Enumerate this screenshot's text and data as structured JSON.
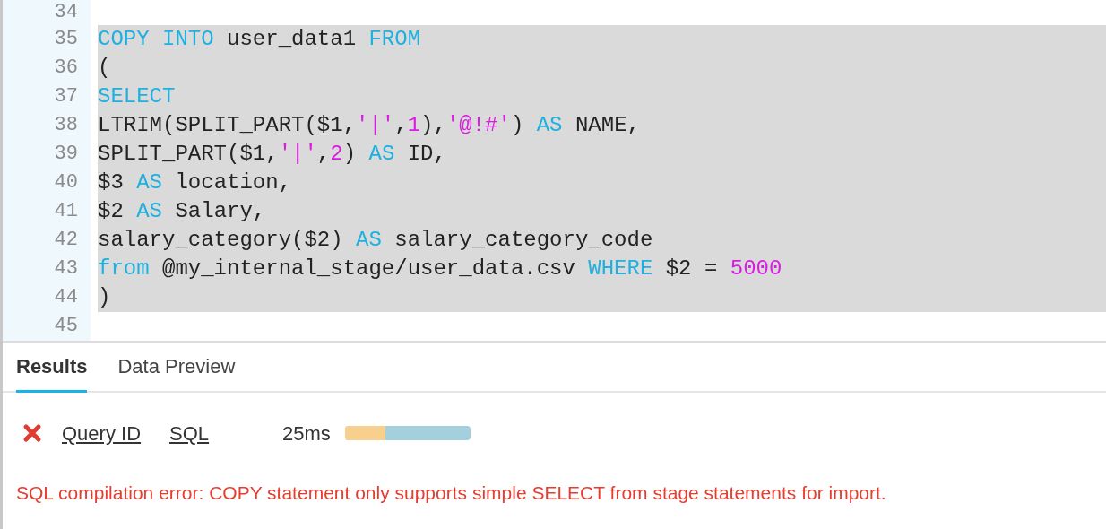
{
  "editor": {
    "lines": [
      {
        "number": "34",
        "selected": false
      },
      {
        "number": "35",
        "selected": true,
        "tokens": [
          {
            "kind": "keyword",
            "text": "COPY INTO"
          },
          {
            "kind": "plain",
            "text": " user_data1 "
          },
          {
            "kind": "keyword",
            "text": "FROM"
          }
        ]
      },
      {
        "number": "36",
        "selected": true,
        "tokens": [
          {
            "kind": "plain",
            "text": "("
          }
        ]
      },
      {
        "number": "37",
        "selected": true,
        "tokens": [
          {
            "kind": "keyword",
            "text": "SELECT"
          }
        ]
      },
      {
        "number": "38",
        "selected": true,
        "tokens": [
          {
            "kind": "plain",
            "text": "LTRIM(SPLIT_PART($1,"
          },
          {
            "kind": "literal",
            "text": "'|'"
          },
          {
            "kind": "plain",
            "text": ","
          },
          {
            "kind": "literal",
            "text": "1"
          },
          {
            "kind": "plain",
            "text": "),"
          },
          {
            "kind": "literal",
            "text": "'@!#'"
          },
          {
            "kind": "plain",
            "text": ") "
          },
          {
            "kind": "keyword",
            "text": "AS"
          },
          {
            "kind": "plain",
            "text": " NAME,"
          }
        ]
      },
      {
        "number": "39",
        "selected": true,
        "tokens": [
          {
            "kind": "plain",
            "text": "SPLIT_PART($1,"
          },
          {
            "kind": "literal",
            "text": "'|'"
          },
          {
            "kind": "plain",
            "text": ","
          },
          {
            "kind": "literal",
            "text": "2"
          },
          {
            "kind": "plain",
            "text": ") "
          },
          {
            "kind": "keyword",
            "text": "AS"
          },
          {
            "kind": "plain",
            "text": " ID,"
          }
        ]
      },
      {
        "number": "40",
        "selected": true,
        "tokens": [
          {
            "kind": "plain",
            "text": "$3 "
          },
          {
            "kind": "keyword",
            "text": "AS"
          },
          {
            "kind": "plain",
            "text": " location,"
          }
        ]
      },
      {
        "number": "41",
        "selected": true,
        "tokens": [
          {
            "kind": "plain",
            "text": "$2 "
          },
          {
            "kind": "keyword",
            "text": "AS"
          },
          {
            "kind": "plain",
            "text": " Salary,"
          }
        ]
      },
      {
        "number": "42",
        "selected": true,
        "tokens": [
          {
            "kind": "plain",
            "text": "salary_category($2) "
          },
          {
            "kind": "keyword",
            "text": "AS"
          },
          {
            "kind": "plain",
            "text": " salary_category_code"
          }
        ]
      },
      {
        "number": "43",
        "selected": true,
        "tokens": [
          {
            "kind": "keyword",
            "text": "from"
          },
          {
            "kind": "plain",
            "text": " @my_internal_stage/user_data.csv "
          },
          {
            "kind": "keyword",
            "text": "WHERE"
          },
          {
            "kind": "plain",
            "text": " $2 = "
          },
          {
            "kind": "literal",
            "text": "5000"
          }
        ]
      },
      {
        "number": "44",
        "selected": true,
        "tokens": [
          {
            "kind": "plain",
            "text": ")"
          }
        ]
      },
      {
        "number": "45",
        "selected": false
      }
    ]
  },
  "tabs": [
    {
      "label": "Results",
      "selected": true
    },
    {
      "label": "Data Preview",
      "selected": false
    }
  ],
  "result": {
    "failed": true,
    "query_id_link": "Query ID",
    "sql_link": "SQL",
    "duration": "25ms",
    "timing": {
      "level": 0.32
    },
    "message": "SQL compilation error: COPY statement only supports simple SELECT from stage statements for import."
  }
}
